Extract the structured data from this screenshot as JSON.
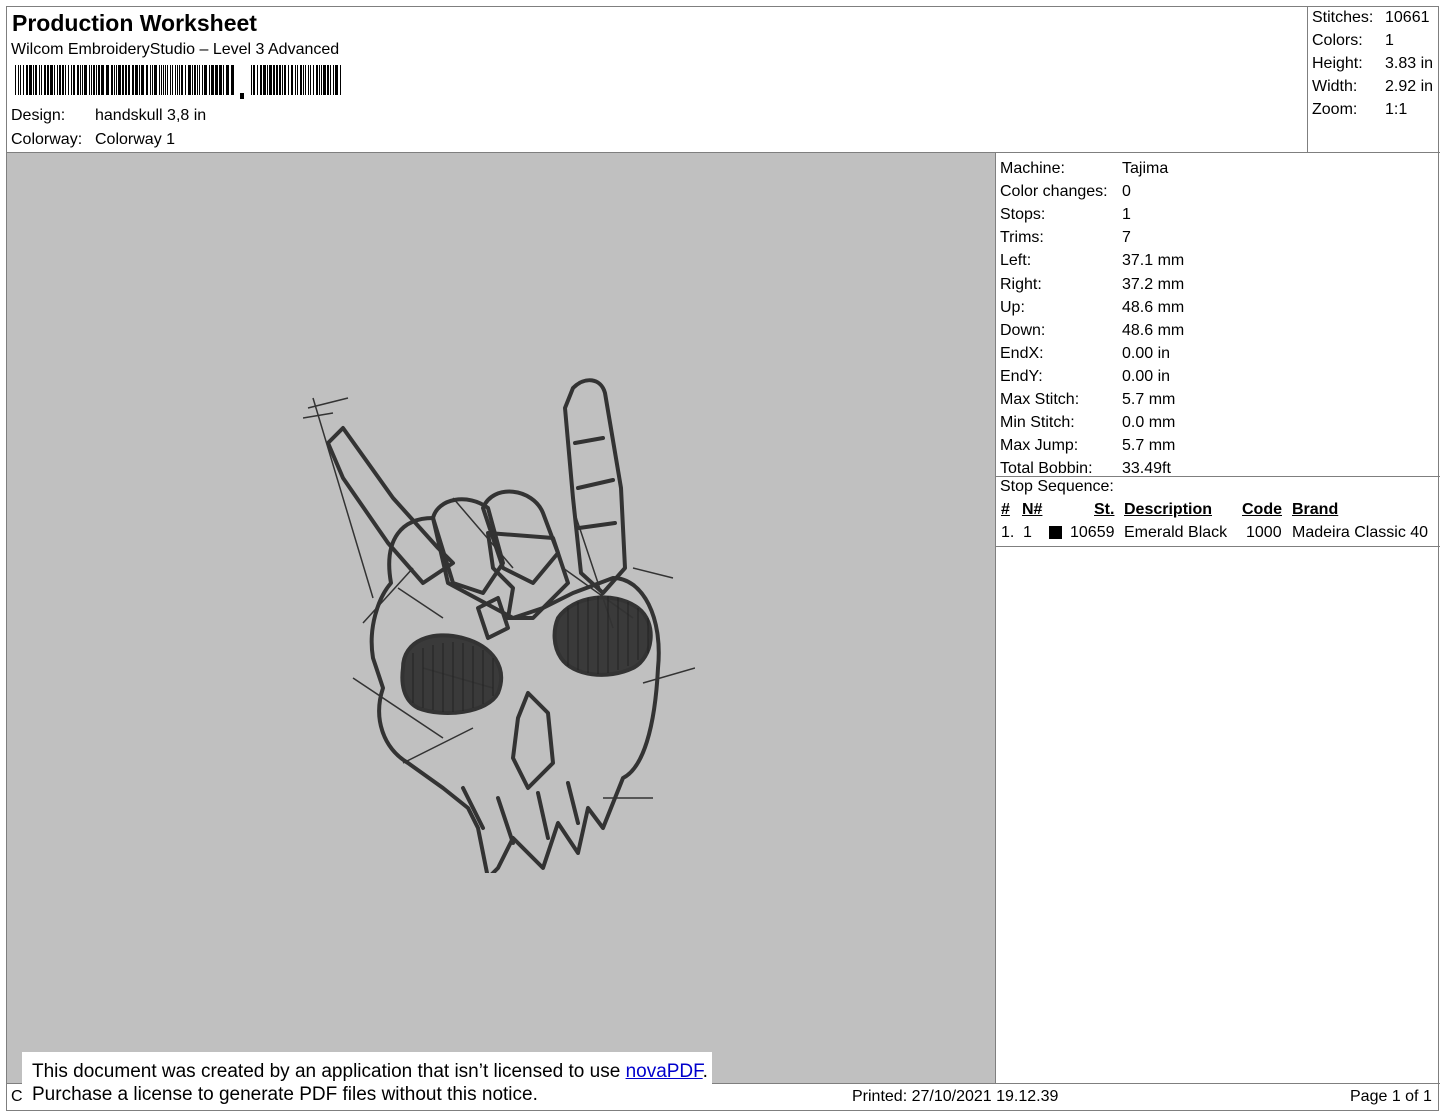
{
  "header": {
    "title": "Production Worksheet",
    "subtitle": "Wilcom EmbroideryStudio – Level 3 Advanced",
    "design_label": "Design:",
    "design_value": "handskull 3,8 in",
    "colorway_label": "Colorway:",
    "colorway_value": "Colorway 1"
  },
  "summary": [
    {
      "label": "Stitches:",
      "value": "10661"
    },
    {
      "label": "Colors:",
      "value": "1"
    },
    {
      "label": "Height:",
      "value": "3.83 in"
    },
    {
      "label": "Width:",
      "value": "2.92 in"
    },
    {
      "label": "Zoom:",
      "value": "1:1"
    }
  ],
  "stats": [
    {
      "label": "Machine:",
      "value": "Tajima"
    },
    {
      "label": "Color changes:",
      "value": "0"
    },
    {
      "label": "Stops:",
      "value": "1"
    },
    {
      "label": "Trims:",
      "value": "7"
    },
    {
      "label": "Left:",
      "value": "37.1 mm"
    },
    {
      "label": "Right:",
      "value": "37.2 mm"
    },
    {
      "label": "Up:",
      "value": "48.6 mm"
    },
    {
      "label": "Down:",
      "value": "48.6 mm"
    },
    {
      "label": "EndX:",
      "value": "0.00 in"
    },
    {
      "label": "EndY:",
      "value": "0.00 in"
    },
    {
      "label": "Max Stitch:",
      "value": "5.7 mm"
    },
    {
      "label": "Min Stitch:",
      "value": "0.0 mm"
    },
    {
      "label": "Max Jump:",
      "value": "5.7 mm"
    },
    {
      "label": "Total Bobbin:",
      "value": "33.49ft"
    }
  ],
  "stop_sequence": {
    "title": "Stop Sequence:",
    "columns": [
      "#",
      "N#",
      "St.",
      "Description",
      "Code",
      "Brand"
    ],
    "rows": [
      {
        "num": "1.",
        "n": "1",
        "swatch_color": "#000000",
        "st": "10659",
        "description": "Emerald Black",
        "code": "1000",
        "brand": "Madeira Classic 40"
      }
    ]
  },
  "colors": {
    "canvas_bg": "#c0c0c0",
    "thread": "#333333"
  },
  "footer": {
    "left_fragment": "Cr",
    "printed": "Printed: 27/10/2021 19.12.39",
    "page": "Page 1 of 1"
  },
  "notice": {
    "line1_prefix": "This document was created by an application that isn’t licensed to use ",
    "line1_link": "novaPDF",
    "line1_suffix": ".",
    "line2": "Purchase a license to generate PDF files without this notice."
  }
}
